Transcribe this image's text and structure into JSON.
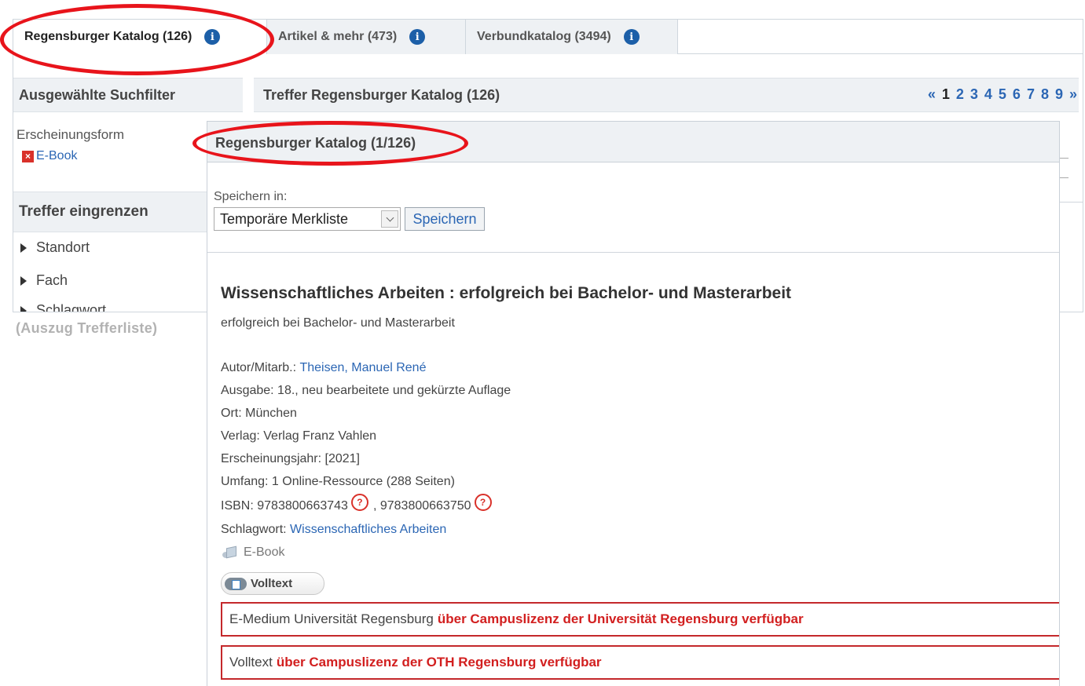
{
  "tabs": [
    {
      "label": "Regensburger Katalog (126)",
      "active": true
    },
    {
      "label": "Artikel & mehr (473)",
      "active": false
    },
    {
      "label": "Verbundkatalog (3494)",
      "active": false
    }
  ],
  "info_icon": {
    "glyph": "i",
    "name": "info-icon"
  },
  "left_panel": {
    "filters_heading": "Ausgewählte Suchfilter",
    "filter_group_title": "Erscheinungsform",
    "active_filter": {
      "icon": "remove-icon",
      "glyph": "×",
      "label": "E-Book"
    },
    "refine_heading": "Treffer eingrenzen",
    "facets": [
      "Standort",
      "Fach",
      "Schlagwort"
    ]
  },
  "results_header": {
    "title": "Treffer Regensburger Katalog (126)",
    "pager": {
      "prev": "«",
      "pages": [
        "1",
        "2",
        "3",
        "4",
        "5",
        "6",
        "7",
        "8",
        "9"
      ],
      "current": "1",
      "next": "»"
    }
  },
  "caption": "(Auszug Trefferliste)",
  "popup": {
    "title": "Regensburger Katalog (1/126)",
    "save_label": "Speichern in:",
    "save_select_value": "Temporäre Merkliste",
    "save_button": "Speichern",
    "record": {
      "title": "Wissenschaftliches Arbeiten :  erfolgreich bei Bachelor- und Masterarbeit",
      "subtitle": "erfolgreich bei Bachelor- und Masterarbeit",
      "author_label": "Autor/Mitarb.:",
      "author_value": "Theisen, Manuel René",
      "edition": "Ausgabe: 18., neu bearbeitete und gekürzte Auflage",
      "place": "Ort: München",
      "publisher": "Verlag: Verlag Franz Vahlen",
      "year": "Erscheinungsjahr: [2021]",
      "extent": "Umfang: 1 Online-Ressource (288 Seiten)",
      "isbn_label": "ISBN:",
      "isbn_1": "9783800663743",
      "isbn_sep": ",",
      "isbn_2": "9783800663750",
      "isbn_icon_glyph": "?",
      "subject_label": "Schlagwort:",
      "subject_value": "Wissenschaftliches Arbeiten",
      "media_type": "E-Book",
      "fulltext_button": "Volltext"
    },
    "availability": [
      {
        "lead": "E-Medium Universität Regensburg",
        "status": "über Campuslizenz der Universität Regensburg verfügbar"
      },
      {
        "lead": "Volltext",
        "status": "über Campuslizenz der OTH Regensburg verfügbar"
      }
    ]
  },
  "colors": {
    "annotation_red": "#e8141b",
    "link_blue": "#2b66b4",
    "status_red": "#d21f1f",
    "header_gray": "#eef1f4"
  }
}
